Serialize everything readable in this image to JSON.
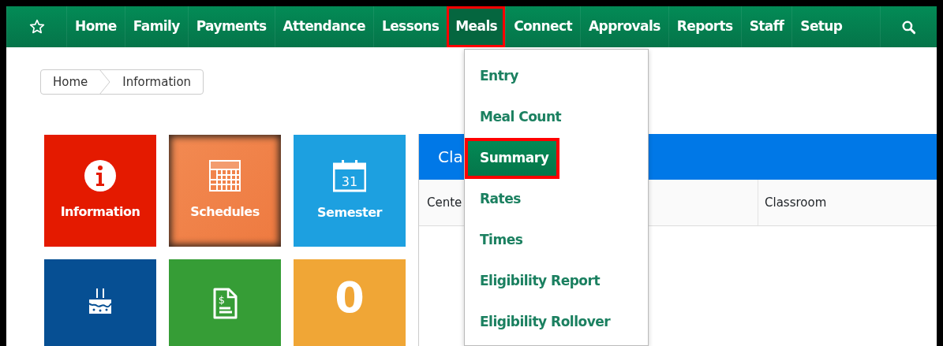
{
  "navbar": {
    "items": [
      {
        "kind": "star",
        "selected": false,
        "highlighted": false
      },
      {
        "kind": "link",
        "label": "Home",
        "selected": false,
        "highlighted": false
      },
      {
        "kind": "link",
        "label": "Family",
        "selected": false,
        "highlighted": false
      },
      {
        "kind": "link",
        "label": "Payments",
        "selected": false,
        "highlighted": false
      },
      {
        "kind": "link",
        "label": "Attendance",
        "selected": false,
        "highlighted": false
      },
      {
        "kind": "link",
        "label": "Lessons",
        "selected": false,
        "highlighted": false
      },
      {
        "kind": "link",
        "label": "Meals",
        "selected": true,
        "highlighted": true
      },
      {
        "kind": "link",
        "label": "Connect",
        "selected": false,
        "highlighted": false
      },
      {
        "kind": "link",
        "label": "Approvals",
        "selected": false,
        "highlighted": false
      },
      {
        "kind": "link",
        "label": "Reports",
        "selected": false,
        "highlighted": false
      },
      {
        "kind": "link",
        "label": "Staff",
        "selected": false,
        "highlighted": false
      },
      {
        "kind": "link",
        "label": "Setup",
        "selected": false,
        "highlighted": false
      },
      {
        "kind": "search",
        "selected": false,
        "highlighted": false
      }
    ]
  },
  "dropdown": {
    "items": [
      {
        "label": "Entry",
        "selected": false,
        "highlighted": false
      },
      {
        "label": "Meal Count",
        "selected": false,
        "highlighted": false
      },
      {
        "label": "Summary",
        "selected": true,
        "highlighted": true
      },
      {
        "label": "Rates",
        "selected": false,
        "highlighted": false
      },
      {
        "label": "Times",
        "selected": false,
        "highlighted": false
      },
      {
        "label": "Eligibility Report",
        "selected": false,
        "highlighted": false
      },
      {
        "label": "Eligibility Rollover",
        "selected": false,
        "highlighted": false
      }
    ]
  },
  "breadcrumb": [
    "Home",
    "Information"
  ],
  "tiles": [
    {
      "kind": "info",
      "label": "Information",
      "color": "#e41a00",
      "selected": false
    },
    {
      "kind": "schedule",
      "label": "Schedules",
      "color": "#f28a52",
      "selected": true
    },
    {
      "kind": "calendar",
      "icon_text": "31",
      "label": "Semester",
      "color": "#1da0e0",
      "selected": false
    },
    {
      "kind": "cake",
      "color": "#064f93",
      "selected": false
    },
    {
      "kind": "bill",
      "icon_text": "$",
      "color": "#369d36",
      "selected": false
    },
    {
      "kind": "count",
      "value": "0",
      "color": "#f0a636",
      "selected": false
    }
  ],
  "panel": {
    "title": "Cla",
    "columns": [
      "Cente",
      "Classroom"
    ]
  }
}
